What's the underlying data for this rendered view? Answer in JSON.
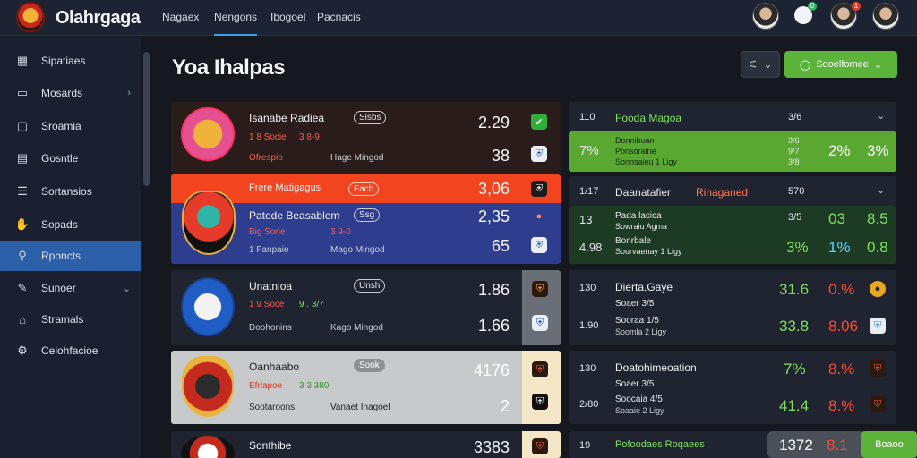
{
  "app": {
    "title": "Olahrgaga"
  },
  "nav": {
    "tabs": [
      "Nagaex",
      "Nengons",
      "Ibogoel",
      "Pacnacis"
    ]
  },
  "notifications": {
    "green_badge": "0",
    "red_badge": "1"
  },
  "sidebar": {
    "items": [
      {
        "label": "Sipatiaes",
        "icon": "grid-icon"
      },
      {
        "label": "Mosards",
        "icon": "message-icon"
      },
      {
        "label": "Sroamia",
        "icon": "chat-icon"
      },
      {
        "label": "Gosntle",
        "icon": "document-icon"
      },
      {
        "label": "Sortansios",
        "icon": "list-icon"
      },
      {
        "label": "Sopads",
        "icon": "thumb-icon"
      },
      {
        "label": "Rponcts",
        "icon": "search-icon"
      },
      {
        "label": "Sunoer",
        "icon": "tool-icon"
      },
      {
        "label": "Stramals",
        "icon": "bank-icon"
      },
      {
        "label": "Celohfacioe",
        "icon": "gear-icon"
      }
    ]
  },
  "page": {
    "title": "Yoa Ihalpas"
  },
  "toolbar": {
    "filter_icon": "sliders-icon",
    "primary_label": "Sooelfomee"
  },
  "matches": [
    {
      "name": "Isanabe Radiea",
      "pill": "Sisbs",
      "sub1": "1 8 Socie",
      "sub1b": "3 8-9",
      "sub2": "Ofrespio",
      "sub2b": "Hage Mingod",
      "odd1": "2.29",
      "odd2": "38"
    },
    {
      "banner": "Frere Matigagus",
      "banner_pill": "Facb",
      "odd_banner": "3,06",
      "name": "Patede Beasablem",
      "pill": "Ssg",
      "sub1": "Big Sorie",
      "sub1b": "3 9-0",
      "sub2": "1 Fanpaie",
      "sub2b": "Mago Mingod",
      "odd1": "2,35",
      "odd2": "65"
    },
    {
      "name": "Unatnioa",
      "pill": "Unsh",
      "sub1": "1 9 Soce",
      "sub1b": "9 . 3/7",
      "sub2": "Doohonins",
      "sub2b": "Kago Mingod",
      "odd1": "1.86",
      "odd2": "1.66"
    },
    {
      "name": "Oanhaabo",
      "pill": "Sook",
      "sub1": "Efrlapoe",
      "sub1b": "3 3 380",
      "sub2": "Sootaroons",
      "sub2b": "Vanaet Inagoel",
      "odd1": "4176",
      "odd2": "2"
    },
    {
      "name": "Sonthibe",
      "odd1": "3383"
    }
  ],
  "right_panels": [
    {
      "num": "110",
      "title": "Fooda Magoa",
      "value": "3/6"
    },
    {
      "num": "7%",
      "lines": [
        "Donnibuan",
        "Ponsoralne",
        "Sonnsaieu 1 Ligy"
      ],
      "vals": [
        "3/6",
        "9/7",
        "3/8"
      ],
      "big1": "2%",
      "big2": "3%"
    },
    {
      "num": "1/17",
      "title": "Daanatafier",
      "title2": "Rinaganed",
      "value": "570"
    },
    {
      "num": "13",
      "lines": [
        "Pada lacica",
        "Sowraiu Agma"
      ],
      "vals": [
        "3/5"
      ],
      "big1": "03",
      "big2": "8.5"
    },
    {
      "num": "4.98",
      "lines": [
        "Bonrbale",
        "Sourvaenay 1 Ligy"
      ],
      "vals": [
        "3%"
      ],
      "big1": "1%",
      "big2": "0.8"
    },
    {
      "num": "130",
      "title": "Dierta.Gaye",
      "sub": "Soaer 3/5",
      "big1": "31.6",
      "big2": "0.%"
    },
    {
      "num": "1.90",
      "title": "Sooraa 1/5",
      "sub": "Soomla 2 Ligy",
      "big1": "33.8",
      "big2": "8.06"
    },
    {
      "num": "130",
      "title": "Doatohimeoation",
      "sub": "Soaer 3/5",
      "big1": "7%",
      "big2": "8.%"
    },
    {
      "num": "2/80",
      "title": "Soocaia 4/5",
      "sub": "Soaaie 2 Ligy",
      "big1": "41.4",
      "big2": "8.%"
    },
    {
      "num": "19",
      "title": "Pofoodaes Roqaees",
      "big1": "1372",
      "big2": "8.1",
      "btn": "Boaoo"
    }
  ],
  "colors": {
    "accent": "#5bb33a",
    "nav_active": "#2b5fa8",
    "danger": "#ff4a38"
  }
}
